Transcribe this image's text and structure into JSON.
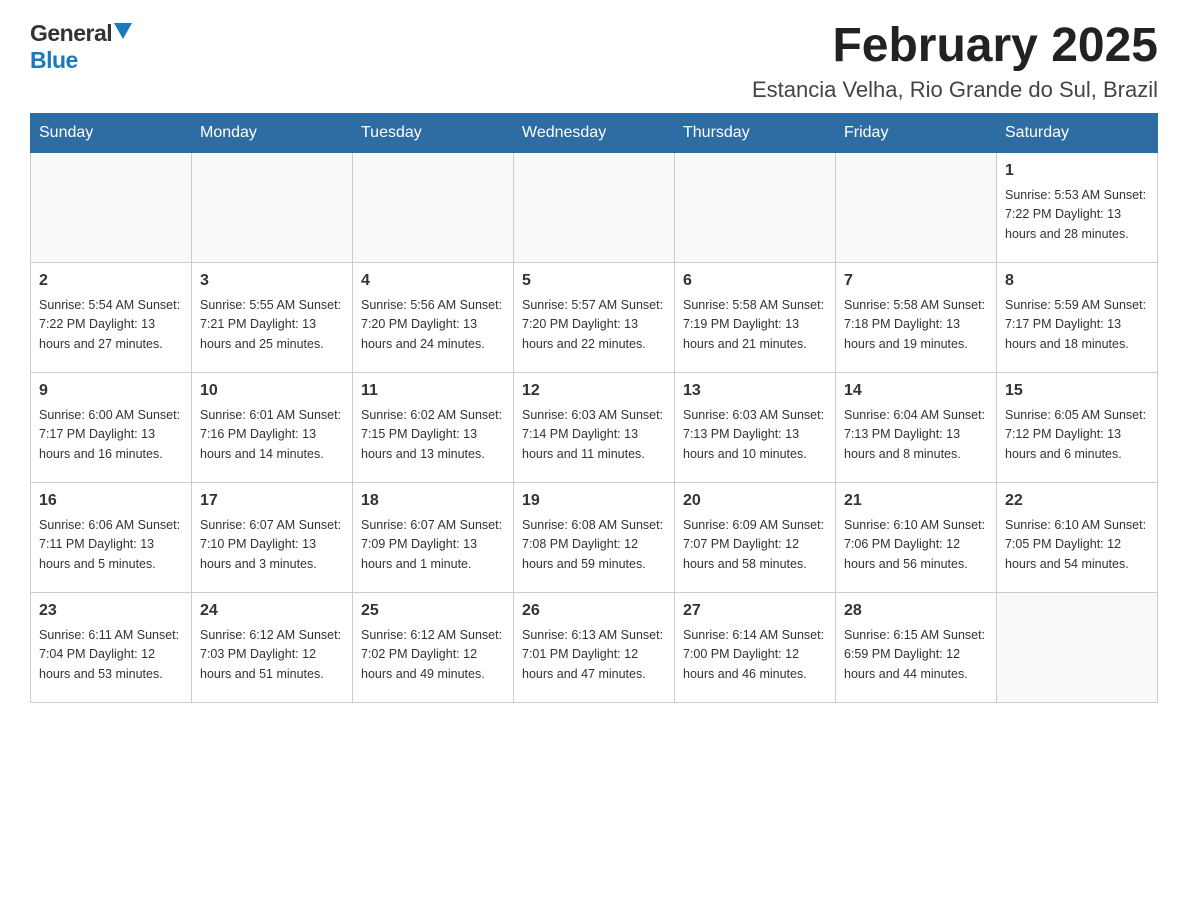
{
  "header": {
    "logo_general": "General",
    "logo_blue": "Blue",
    "month_title": "February 2025",
    "location": "Estancia Velha, Rio Grande do Sul, Brazil"
  },
  "days_of_week": [
    "Sunday",
    "Monday",
    "Tuesday",
    "Wednesday",
    "Thursday",
    "Friday",
    "Saturday"
  ],
  "weeks": [
    [
      {
        "day": "",
        "info": ""
      },
      {
        "day": "",
        "info": ""
      },
      {
        "day": "",
        "info": ""
      },
      {
        "day": "",
        "info": ""
      },
      {
        "day": "",
        "info": ""
      },
      {
        "day": "",
        "info": ""
      },
      {
        "day": "1",
        "info": "Sunrise: 5:53 AM\nSunset: 7:22 PM\nDaylight: 13 hours and 28 minutes."
      }
    ],
    [
      {
        "day": "2",
        "info": "Sunrise: 5:54 AM\nSunset: 7:22 PM\nDaylight: 13 hours and 27 minutes."
      },
      {
        "day": "3",
        "info": "Sunrise: 5:55 AM\nSunset: 7:21 PM\nDaylight: 13 hours and 25 minutes."
      },
      {
        "day": "4",
        "info": "Sunrise: 5:56 AM\nSunset: 7:20 PM\nDaylight: 13 hours and 24 minutes."
      },
      {
        "day": "5",
        "info": "Sunrise: 5:57 AM\nSunset: 7:20 PM\nDaylight: 13 hours and 22 minutes."
      },
      {
        "day": "6",
        "info": "Sunrise: 5:58 AM\nSunset: 7:19 PM\nDaylight: 13 hours and 21 minutes."
      },
      {
        "day": "7",
        "info": "Sunrise: 5:58 AM\nSunset: 7:18 PM\nDaylight: 13 hours and 19 minutes."
      },
      {
        "day": "8",
        "info": "Sunrise: 5:59 AM\nSunset: 7:17 PM\nDaylight: 13 hours and 18 minutes."
      }
    ],
    [
      {
        "day": "9",
        "info": "Sunrise: 6:00 AM\nSunset: 7:17 PM\nDaylight: 13 hours and 16 minutes."
      },
      {
        "day": "10",
        "info": "Sunrise: 6:01 AM\nSunset: 7:16 PM\nDaylight: 13 hours and 14 minutes."
      },
      {
        "day": "11",
        "info": "Sunrise: 6:02 AM\nSunset: 7:15 PM\nDaylight: 13 hours and 13 minutes."
      },
      {
        "day": "12",
        "info": "Sunrise: 6:03 AM\nSunset: 7:14 PM\nDaylight: 13 hours and 11 minutes."
      },
      {
        "day": "13",
        "info": "Sunrise: 6:03 AM\nSunset: 7:13 PM\nDaylight: 13 hours and 10 minutes."
      },
      {
        "day": "14",
        "info": "Sunrise: 6:04 AM\nSunset: 7:13 PM\nDaylight: 13 hours and 8 minutes."
      },
      {
        "day": "15",
        "info": "Sunrise: 6:05 AM\nSunset: 7:12 PM\nDaylight: 13 hours and 6 minutes."
      }
    ],
    [
      {
        "day": "16",
        "info": "Sunrise: 6:06 AM\nSunset: 7:11 PM\nDaylight: 13 hours and 5 minutes."
      },
      {
        "day": "17",
        "info": "Sunrise: 6:07 AM\nSunset: 7:10 PM\nDaylight: 13 hours and 3 minutes."
      },
      {
        "day": "18",
        "info": "Sunrise: 6:07 AM\nSunset: 7:09 PM\nDaylight: 13 hours and 1 minute."
      },
      {
        "day": "19",
        "info": "Sunrise: 6:08 AM\nSunset: 7:08 PM\nDaylight: 12 hours and 59 minutes."
      },
      {
        "day": "20",
        "info": "Sunrise: 6:09 AM\nSunset: 7:07 PM\nDaylight: 12 hours and 58 minutes."
      },
      {
        "day": "21",
        "info": "Sunrise: 6:10 AM\nSunset: 7:06 PM\nDaylight: 12 hours and 56 minutes."
      },
      {
        "day": "22",
        "info": "Sunrise: 6:10 AM\nSunset: 7:05 PM\nDaylight: 12 hours and 54 minutes."
      }
    ],
    [
      {
        "day": "23",
        "info": "Sunrise: 6:11 AM\nSunset: 7:04 PM\nDaylight: 12 hours and 53 minutes."
      },
      {
        "day": "24",
        "info": "Sunrise: 6:12 AM\nSunset: 7:03 PM\nDaylight: 12 hours and 51 minutes."
      },
      {
        "day": "25",
        "info": "Sunrise: 6:12 AM\nSunset: 7:02 PM\nDaylight: 12 hours and 49 minutes."
      },
      {
        "day": "26",
        "info": "Sunrise: 6:13 AM\nSunset: 7:01 PM\nDaylight: 12 hours and 47 minutes."
      },
      {
        "day": "27",
        "info": "Sunrise: 6:14 AM\nSunset: 7:00 PM\nDaylight: 12 hours and 46 minutes."
      },
      {
        "day": "28",
        "info": "Sunrise: 6:15 AM\nSunset: 6:59 PM\nDaylight: 12 hours and 44 minutes."
      },
      {
        "day": "",
        "info": ""
      }
    ]
  ]
}
